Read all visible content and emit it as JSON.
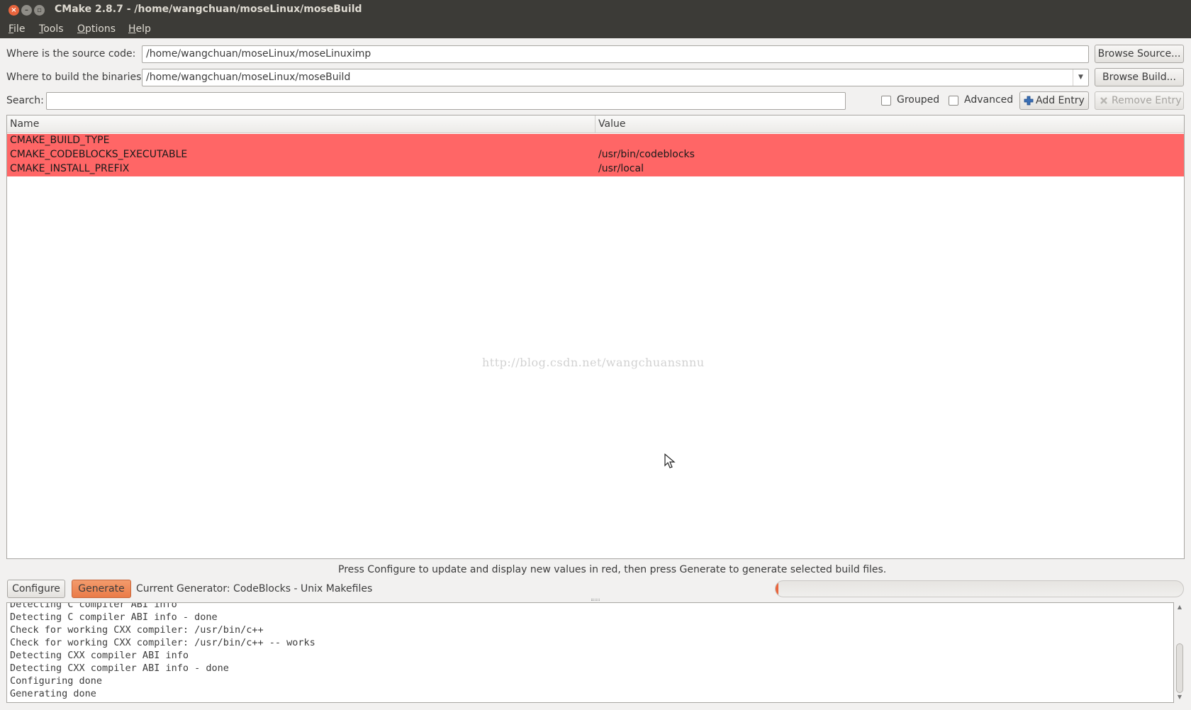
{
  "window": {
    "title": "CMake 2.8.7 - /home/wangchuan/moseLinux/moseBuild",
    "controls": {
      "close": "×",
      "minimize": "–",
      "maximize": "▫"
    }
  },
  "menubar": {
    "items": [
      {
        "label": "File"
      },
      {
        "label": "Tools"
      },
      {
        "label": "Options"
      },
      {
        "label": "Help"
      }
    ]
  },
  "source": {
    "label": "Where is the source code:",
    "value": "/home/wangchuan/moseLinux/moseLinuximp",
    "browse_label": "Browse Source..."
  },
  "build": {
    "label": "Where to build the binaries:",
    "value": "/home/wangchuan/moseLinux/moseBuild",
    "dropdown_glyph": "▼",
    "browse_label": "Browse Build..."
  },
  "search": {
    "label": "Search:",
    "value": ""
  },
  "options": {
    "grouped_label": "Grouped",
    "grouped_checked": false,
    "advanced_label": "Advanced",
    "advanced_checked": false,
    "add_entry_label": "Add Entry",
    "remove_entry_label": "Remove Entry"
  },
  "table": {
    "columns": [
      "Name",
      "Value"
    ],
    "rows": [
      {
        "name": "CMAKE_BUILD_TYPE",
        "value": ""
      },
      {
        "name": "CMAKE_CODEBLOCKS_EXECUTABLE",
        "value": "/usr/bin/codeblocks"
      },
      {
        "name": "CMAKE_INSTALL_PREFIX",
        "value": "/usr/local"
      }
    ],
    "new_value_color": "#ff6666"
  },
  "watermark": "http://blog.csdn.net/wangchuansnnu",
  "hint": "Press Configure to update and display new values in red, then press Generate to generate selected build files.",
  "actions": {
    "configure_label": "Configure",
    "generate_label": "Generate",
    "generator_text": "Current Generator: CodeBlocks - Unix Makefiles"
  },
  "progress": {
    "fraction": 0.005
  },
  "output": {
    "lines": [
      "Detecting C compiler ABI info",
      "Detecting C compiler ABI info - done",
      "Check for working CXX compiler: /usr/bin/c++",
      "Check for working CXX compiler: /usr/bin/c++ -- works",
      "Detecting CXX compiler ABI info",
      "Detecting CXX compiler ABI info - done",
      "Configuring done",
      "Generating done"
    ]
  },
  "colors": {
    "titlebar": "#3c3b37",
    "accent": "#e9653d",
    "generate_button": "#ea7b48"
  }
}
